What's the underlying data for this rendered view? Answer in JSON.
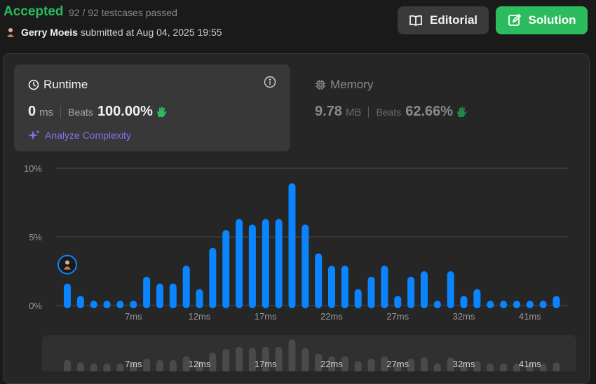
{
  "header": {
    "status": "Accepted",
    "testcases": "92 / 92 testcases passed",
    "username": "Gerry Moeis",
    "submitted_text": "submitted at Aug 04, 2025 19:55"
  },
  "buttons": {
    "editorial": "Editorial",
    "solution": "Solution"
  },
  "runtime": {
    "title": "Runtime",
    "value": "0",
    "unit": "ms",
    "beats_label": "Beats",
    "beats": "100.00%",
    "analyze": "Analyze Complexity"
  },
  "memory": {
    "title": "Memory",
    "value": "9.78",
    "unit": "MB",
    "beats_label": "Beats",
    "beats": "62.66%"
  },
  "colors": {
    "accent_green": "#2cbb5d",
    "bar_blue": "#0a84ff",
    "analyze_purple": "#8e6cf0"
  },
  "chart_data": {
    "type": "bar",
    "ylabel_ticks": [
      "0%",
      "5%",
      "10%"
    ],
    "ylim": [
      0,
      10
    ],
    "x_tick_labels": [
      "7ms",
      "12ms",
      "17ms",
      "22ms",
      "27ms",
      "32ms",
      "41ms"
    ],
    "x_tick_indices": [
      5,
      10,
      15,
      20,
      25,
      30,
      35
    ],
    "values": [
      1.6,
      0.7,
      0.35,
      0.35,
      0.35,
      0.35,
      2.1,
      1.6,
      1.6,
      2.9,
      1.2,
      4.2,
      5.5,
      6.3,
      5.9,
      6.3,
      6.3,
      8.9,
      5.9,
      3.8,
      2.9,
      2.9,
      1.2,
      2.1,
      2.9,
      0.7,
      2.1,
      2.5,
      0.35,
      2.5,
      0.7,
      1.2,
      0.35,
      0.35,
      0.35,
      0.35,
      0.35,
      0.7
    ],
    "highlight_index": 0,
    "grid": true
  },
  "minimap": {
    "x_tick_labels": [
      "7ms",
      "12ms",
      "17ms",
      "22ms",
      "27ms",
      "32ms",
      "41ms"
    ]
  }
}
